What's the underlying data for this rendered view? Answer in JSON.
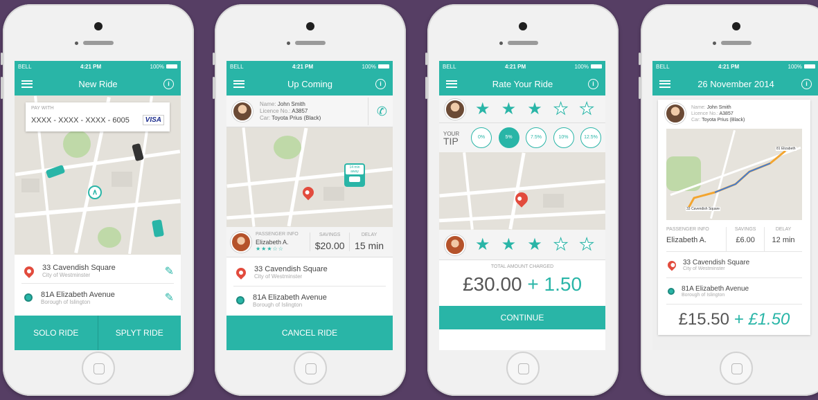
{
  "status": {
    "carrier": "BELL",
    "time": "4:21 PM",
    "battery": "100%"
  },
  "s1": {
    "title": "New Ride",
    "pay_label": "PAY WITH",
    "card_number": "XXXX - XXXX - XXXX - 6005",
    "card_brand": "VISA",
    "from_title": "33 Cavendish Square",
    "from_sub": "City of Westminster",
    "to_title": "81A Elizabeth Avenue",
    "to_sub": "Borough of Islington",
    "btn_solo": "SOLO RIDE",
    "btn_splyt": "SPLYT RIDE"
  },
  "s2": {
    "title": "Up Coming",
    "driver_name_label": "Name:",
    "driver_name": "John Smith",
    "licence_label": "Licence No.:",
    "licence": "A3857",
    "car_label": "Car:",
    "car": "Toyota Prius (Black)",
    "eta": "14 min away",
    "pass_label": "PASSENGER INFO",
    "savings_label": "SAVINGS",
    "delay_label": "DELAY",
    "pass_name": "Elizabeth A.",
    "pass_rating": 3,
    "savings": "$20.00",
    "delay": "15 min",
    "from_title": "33 Cavendish Square",
    "from_sub": "City of Westminster",
    "to_title": "81A Elizabeth Avenue",
    "to_sub": "Borough of Islington",
    "btn_cancel": "CANCEL RIDE"
  },
  "s3": {
    "title": "Rate Your Ride",
    "driver_rating": 3,
    "tip_your": "YOUR",
    "tip_tip": "TIP",
    "tips": [
      "0%",
      "5%",
      "7.5%",
      "10%",
      "12.5%"
    ],
    "tip_selected": 1,
    "passenger_rating": 3,
    "total_label": "TOTAL AMOUNT CHARGED",
    "total": "£30.00",
    "total_tip": "+ 1.50",
    "btn_continue": "CONTINUE"
  },
  "s4": {
    "title": "26 November 2014",
    "driver_name_label": "Name:",
    "driver_name": "John Smith",
    "licence_label": "Licence No.:",
    "licence": "A3857",
    "car_label": "Car:",
    "car": "Toyota Prius (Black)",
    "map_end": "81 Elizabeth",
    "map_start": "33 Cavendish Square",
    "pass_label": "PASSENGER INFO",
    "savings_label": "SAVINGS",
    "delay_label": "DELAY",
    "pass_name": "Elizabeth A.",
    "savings": "£6.00",
    "delay": "12 min",
    "from_title": "33 Cavendish Square",
    "from_sub": "City of Westminster",
    "to_title": "81A Elizabeth Avenue",
    "to_sub": "Borough of Islington",
    "total": "£15.50",
    "total_tip": "+ £1.50"
  },
  "colors": {
    "accent": "#29b5a7",
    "pin": "#e24b3d",
    "background": "#563e64"
  }
}
